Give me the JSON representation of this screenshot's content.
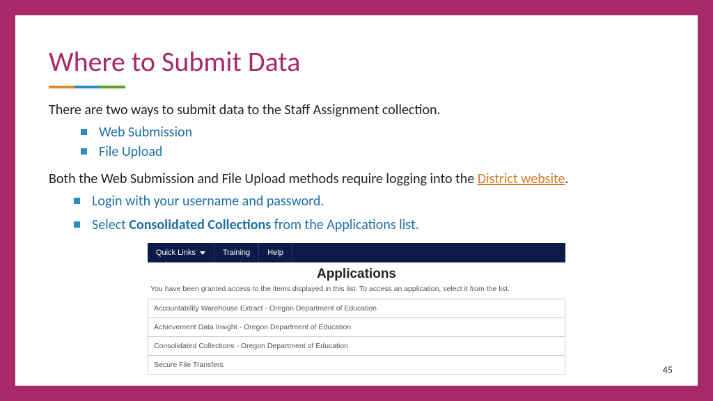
{
  "title": "Where to Submit Data",
  "intro": "There are two ways to submit data to the Staff Assignment collection.",
  "ways": [
    "Web Submission",
    "File Upload"
  ],
  "both_prefix": "Both the Web Submission and File Upload methods require logging into the ",
  "link_text": "District website",
  "both_suffix": ".",
  "steps": {
    "login": "Login with your username and password.",
    "select_prefix": "Select ",
    "select_bold": "Consolidated Collections",
    "select_suffix": " from the Applications list."
  },
  "app": {
    "nav": {
      "quicklinks": "Quick Links",
      "training": "Training",
      "help": "Help"
    },
    "heading": "Applications",
    "subtitle": "You have been granted access to the items displayed in this list. To access an application, select it from the list.",
    "rows": [
      "Accountability Warehouse Extract - Oregon Department of Education",
      "Achievement Data Insight - Oregon Department of Education",
      "Consolidated Collections - Oregon Department of Education",
      "Secure File Transfers"
    ]
  },
  "page_number": "45"
}
